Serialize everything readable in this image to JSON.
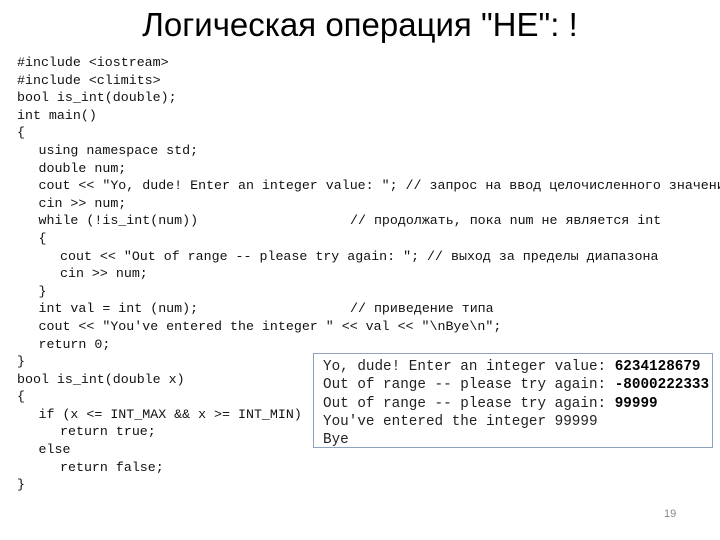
{
  "title": "Логическая операция \"НЕ\": !",
  "code_lines": [
    {
      "indent": 0,
      "code": "#include <iostream>"
    },
    {
      "indent": 0,
      "code": "#include <climits>"
    },
    {
      "indent": 0,
      "code": "bool is_int(double);"
    },
    {
      "indent": 0,
      "code": "int main()"
    },
    {
      "indent": 0,
      "code": "{"
    },
    {
      "indent": 1,
      "code": "using namespace std;"
    },
    {
      "indent": 1,
      "code": "double num;"
    },
    {
      "indent": 1,
      "code": "cout << \"Yo, dude! Enter an integer value: \"; // запрос на ввод целочисленного значения"
    },
    {
      "indent": 1,
      "code": "cin >> num;"
    },
    {
      "indent": 1,
      "code": "while (!is_int(num))",
      "comment": "// продолжать, пока num не является int"
    },
    {
      "indent": 1,
      "code": "{"
    },
    {
      "indent": 2,
      "code": "cout << \"Out of range -- please try again: \"; // выход за пределы диапазона"
    },
    {
      "indent": 2,
      "code": "cin >> num;"
    },
    {
      "indent": 1,
      "code": "}"
    },
    {
      "indent": 1,
      "code": "int val = int (num);",
      "comment": "// приведение типа"
    },
    {
      "indent": 1,
      "code": "cout << \"You've entered the integer \" << val << \"\\nBye\\n\";"
    },
    {
      "indent": 1,
      "code": "return 0;"
    },
    {
      "indent": 0,
      "code": "}"
    },
    {
      "indent": 0,
      "code": "bool is_int(double x)"
    },
    {
      "indent": 0,
      "code": "{"
    },
    {
      "indent": 1,
      "code": "if (x <= INT_MAX && x >= INT_MIN)"
    },
    {
      "indent": 2,
      "code": "return true;"
    },
    {
      "indent": 1,
      "code": "else"
    },
    {
      "indent": 2,
      "code": "return false;"
    },
    {
      "indent": 0,
      "code": "}"
    }
  ],
  "console_lines": [
    {
      "text": "Yo, dude! Enter an integer value: ",
      "input": "6234128679"
    },
    {
      "text": "Out of range -- please try again: ",
      "input": "-8000222333"
    },
    {
      "text": "Out of range -- please try again: ",
      "input": "99999"
    },
    {
      "text": "You've entered the integer 99999",
      "input": ""
    },
    {
      "text": "Bye",
      "input": ""
    }
  ],
  "page_number": "19"
}
